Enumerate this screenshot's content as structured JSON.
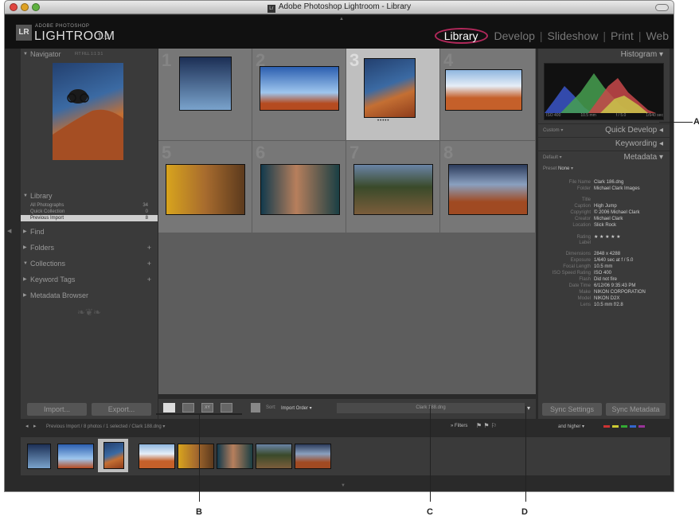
{
  "window": {
    "title": "Adobe Photoshop Lightroom - Library"
  },
  "identity": {
    "adobe_photoshop": "ADOBE PHOTOSHOP",
    "lightroom": "LIGHTROOM",
    "version": "1.0",
    "lr_badge": "LR"
  },
  "modules": [
    {
      "label": "Library"
    },
    {
      "label": "Develop"
    },
    {
      "label": "Slideshow"
    },
    {
      "label": "Print"
    },
    {
      "label": "Web"
    }
  ],
  "left_panel": {
    "navigator": "Navigator",
    "nav_options": "FIT  FILL  1:1  3:1",
    "library": "Library",
    "library_rows": [
      {
        "label": "All Photographs",
        "count": "34"
      },
      {
        "label": "Quick Collection",
        "count": "0"
      },
      {
        "label": "Previous Import",
        "count": "8"
      }
    ],
    "find": "Find",
    "folders": "Folders",
    "collections": "Collections",
    "keyword_tags": "Keyword Tags",
    "metadata_browser": "Metadata Browser",
    "import": "Import...",
    "export": "Export..."
  },
  "grid": {
    "numbers": [
      "1",
      "2",
      "3",
      "4",
      "5",
      "6",
      "7",
      "8"
    ],
    "rating_dots": "•••••"
  },
  "right_panel": {
    "histogram": "Histogram",
    "histo_info": [
      "ISO 400",
      "10.5 mm",
      "f / 5.0",
      "1/640 sec"
    ],
    "custom": "Custom",
    "quick_develop": "Quick Develop",
    "keywording": "Keywording",
    "default": "Default",
    "metadata": "Metadata",
    "preset_label": "Preset",
    "preset_value": "None",
    "meta_rows": [
      {
        "k": "File Name",
        "v": "Clark 186.dng"
      },
      {
        "k": "Folder",
        "v": "Michael Clark Images"
      },
      {
        "k": "Title",
        "v": ""
      },
      {
        "k": "Caption",
        "v": "High Jump"
      },
      {
        "k": "Copyright",
        "v": "© 2006 Michael Clark"
      },
      {
        "k": "Creator",
        "v": "Michael Clark"
      },
      {
        "k": "Location",
        "v": "Slick Rock"
      },
      {
        "k": "Rating",
        "v": "★ ★ ★ ★ ★"
      },
      {
        "k": "Label",
        "v": ""
      },
      {
        "k": "Dimensions",
        "v": "2848 x 4288"
      },
      {
        "k": "Exposure",
        "v": "1/640 sec at f / 5.0"
      },
      {
        "k": "Focal Length",
        "v": "10.5 mm"
      },
      {
        "k": "ISO Speed Rating",
        "v": "ISO 400"
      },
      {
        "k": "Flash",
        "v": "Did not fire"
      },
      {
        "k": "Date Time",
        "v": "6/12/06 9:35:43 PM"
      },
      {
        "k": "Make",
        "v": "NIKON CORPORATION"
      },
      {
        "k": "Model",
        "v": "NIKON D2X"
      },
      {
        "k": "Lens",
        "v": "10.5 mm f/2.8"
      }
    ],
    "sync_settings": "Sync Settings",
    "sync_metadata": "Sync Metadata"
  },
  "toolbar": {
    "sort_label": "Sort:",
    "sort_value": "Import Order",
    "filename": "Clark 188.dng"
  },
  "filmstrip_bar": {
    "path": "Previous Import / 8 photos / 1 selected / Clark 188.dng",
    "filters": "Filters",
    "higher": "and higher"
  },
  "callouts": {
    "a": "A",
    "b": "B",
    "c": "C",
    "d": "D"
  }
}
